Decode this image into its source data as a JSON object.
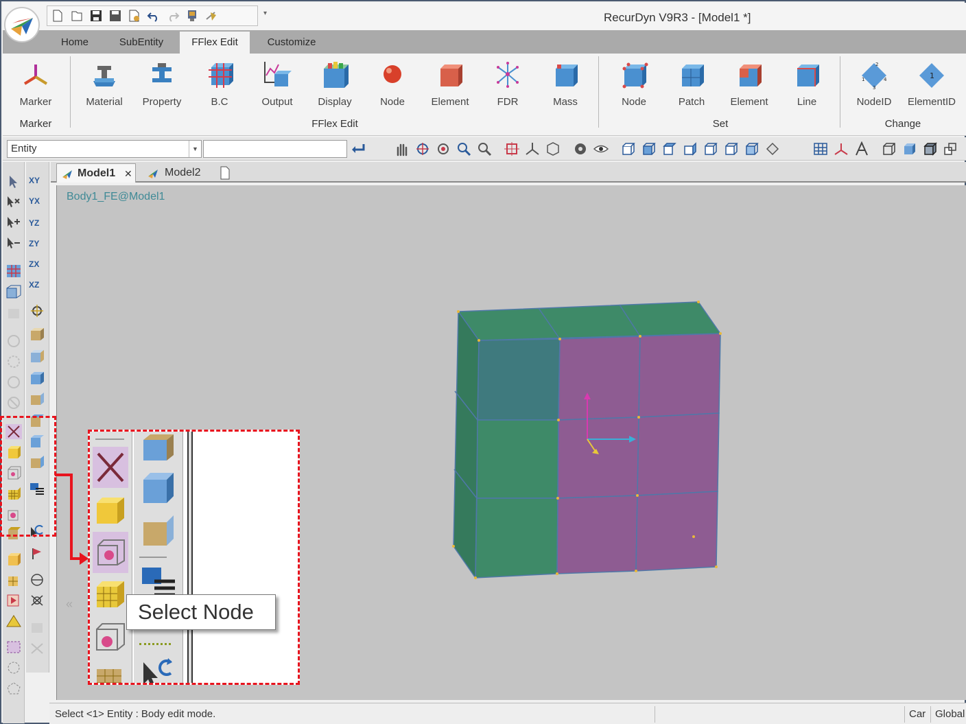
{
  "window": {
    "title": "RecurDyn V9R3  - [Model1 *]"
  },
  "ribbon_tabs": [
    "Home",
    "SubEntity",
    "FFlex Edit",
    "Customize"
  ],
  "active_tab": "FFlex Edit",
  "ribbon": {
    "groups": {
      "marker": {
        "label": "Marker",
        "buttons": [
          "Marker"
        ]
      },
      "fflex_edit": {
        "label": "FFlex Edit",
        "buttons": [
          "Material",
          "Property",
          "B.C",
          "Output",
          "Display",
          "Node",
          "Element",
          "FDR",
          "Mass"
        ]
      },
      "set": {
        "label": "Set",
        "buttons": [
          "Node",
          "Patch",
          "Element",
          "Line"
        ]
      },
      "change": {
        "label": "Change",
        "buttons": [
          "NodeID",
          "ElementID"
        ]
      }
    }
  },
  "toolbar": {
    "entity_combo": "Entity",
    "entity_input": ""
  },
  "left_toolbar2": [
    "XY",
    "YX",
    "YZ",
    "ZY",
    "ZX",
    "XZ"
  ],
  "doc_tabs": [
    "Model1",
    "Model2"
  ],
  "viewport": {
    "label": "Body1_FE@Model1"
  },
  "tooltip": "Select Node",
  "status": {
    "text": "Select <1> Entity : Body edit mode.",
    "coord_system": "Car",
    "reference": "Global"
  },
  "colors": {
    "accent_red": "#e8141e",
    "mesh_green": "#3e8a68",
    "mesh_purple": "#8e5c92",
    "edge_blue": "#4f78a8",
    "label_teal": "#3f8a96"
  }
}
